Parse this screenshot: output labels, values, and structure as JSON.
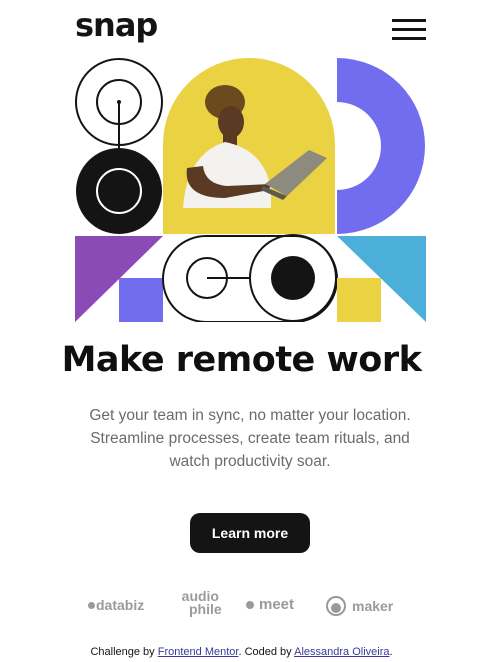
{
  "header": {
    "logo": "snap",
    "menu_icon": "hamburger-menu-icon"
  },
  "hero": {
    "title": "Make remote work",
    "description": "Get your team in sync, no matter your location. Streamline processes, create team rituals, and watch productivity soar.",
    "cta_label": "Learn more"
  },
  "clients": [
    {
      "name": "databiz"
    },
    {
      "name_top": "audio",
      "name_bottom": "phile"
    },
    {
      "name": "meet"
    },
    {
      "name": "maker"
    }
  ],
  "footer": {
    "prefix": "Challenge by ",
    "link1": "Frontend Mentor",
    "middle": ". Coded by ",
    "link2": "Alessandra Oliveira",
    "suffix": "."
  },
  "colors": {
    "purple": "#726CEE",
    "yellow": "#EBD243",
    "blue": "#4BAFDA",
    "violet": "#8A4BB7",
    "dark": "#141414"
  }
}
